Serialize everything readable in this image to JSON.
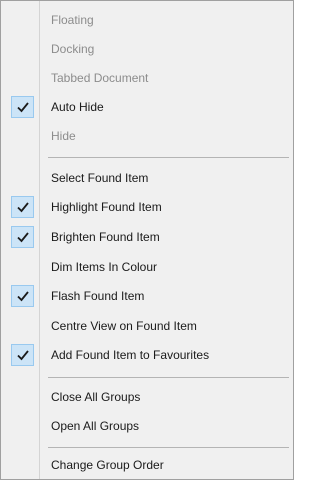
{
  "menu": {
    "items": [
      {
        "label": "Floating",
        "checked": false,
        "disabled": true
      },
      {
        "label": "Docking",
        "checked": false,
        "disabled": true
      },
      {
        "label": "Tabbed Document",
        "checked": false,
        "disabled": true
      },
      {
        "label": "Auto Hide",
        "checked": true,
        "disabled": false
      },
      {
        "label": "Hide",
        "checked": false,
        "disabled": true
      },
      {
        "label": "Select Found Item",
        "checked": false,
        "disabled": false
      },
      {
        "label": "Highlight Found Item",
        "checked": true,
        "disabled": false
      },
      {
        "label": "Brighten Found Item",
        "checked": true,
        "disabled": false
      },
      {
        "label": "Dim Items In Colour",
        "checked": false,
        "disabled": false
      },
      {
        "label": "Flash Found Item",
        "checked": true,
        "disabled": false
      },
      {
        "label": "Centre View on Found Item",
        "checked": false,
        "disabled": false
      },
      {
        "label": "Add Found Item to Favourites",
        "checked": true,
        "disabled": false
      },
      {
        "label": "Close All Groups",
        "checked": false,
        "disabled": false
      },
      {
        "label": "Open All Groups",
        "checked": false,
        "disabled": false
      },
      {
        "label": "Change Group Order",
        "checked": false,
        "disabled": false
      }
    ]
  }
}
